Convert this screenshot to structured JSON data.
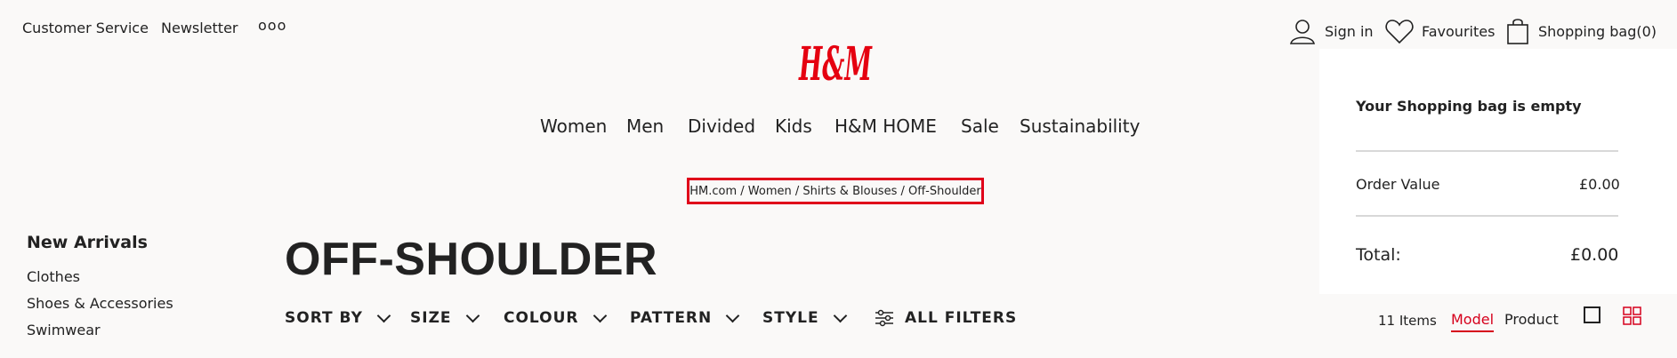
{
  "top_links": {
    "customer_service": "Customer Service",
    "newsletter": "Newsletter",
    "more": "ooo"
  },
  "brand": {
    "logo_text": "H&M",
    "color": "#e50010"
  },
  "header_actions": {
    "sign_in": "Sign in",
    "favourites": "Favourites",
    "shopping_bag": "Shopping bag",
    "bag_count": "(0)"
  },
  "main_nav": [
    "Women",
    "Men",
    "Divided",
    "Kids",
    "H&M HOME",
    "Sale",
    "Sustainability"
  ],
  "breadcrumb": "HM.com / Women / Shirts & Blouses / Off-Shoulder",
  "sidebar": {
    "heading": "New Arrivals",
    "items": [
      "Clothes",
      "Shoes & Accessories",
      "Swimwear"
    ]
  },
  "page_title": "OFF-SHOULDER",
  "filters": {
    "sort_by": "SORT BY",
    "size": "SIZE",
    "colour": "COLOUR",
    "pattern": "PATTERN",
    "style": "STYLE",
    "all_filters": "ALL FILTERS"
  },
  "results": {
    "count": "11 Items",
    "view_model": "Model",
    "view_product": "Product"
  },
  "bag_panel": {
    "title": "Your Shopping bag is empty",
    "order_value_label": "Order Value",
    "order_value": "£0.00",
    "total_label": "Total:",
    "total_value": "£0.00"
  },
  "colors": {
    "accent": "#d6001c",
    "highlight_border": "#e0001a"
  }
}
